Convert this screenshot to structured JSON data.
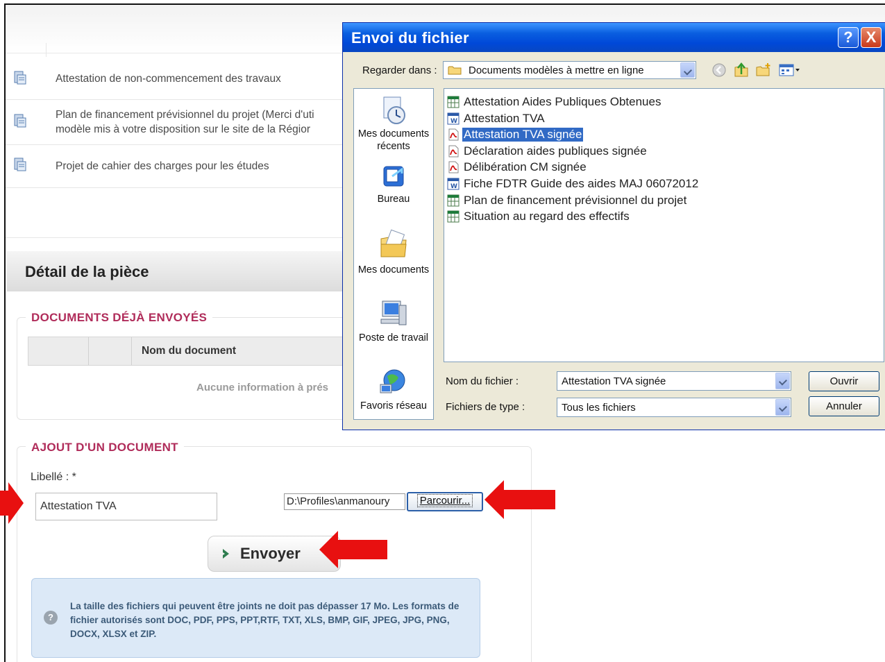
{
  "web": {
    "documents": [
      {
        "label": "Attestation de non-commencement des travaux"
      },
      {
        "label": "Plan de financement prévisionnel du projet (Merci d'uti\nmodèle mis à votre disposition sur le site de la Régior"
      },
      {
        "label": "Projet de cahier des charges pour les études"
      }
    ],
    "detail_title": "Détail de la pièce",
    "sent_docs_legend": "DOCUMENTS DÉJÀ ENVOYÉS",
    "table_header": "Nom du document",
    "empty_message": "Aucune information à prés",
    "add_legend": "AJOUT D'UN DOCUMENT",
    "libelle_label": "Libellé : *",
    "libelle_value": "Attestation TVA",
    "file_path": "D:\\Profiles\\anmanoury",
    "browse_label": "Parcourir...",
    "send_label": "Envoyer",
    "info_text": "La taille des fichiers qui peuvent être joints ne doit pas dépasser 17 Mo. Les formats de fichier autorisés sont DOC, PDF, PPS, PPT,RTF, TXT, XLS, BMP, GIF, JPEG, JPG, PNG, DOCX, XLSX et ZIP."
  },
  "dialog": {
    "title": "Envoi du fichier",
    "help_label": "?",
    "close_label": "X",
    "look_in_label": "Regarder dans :",
    "look_in_value": "Documents modèles à mettre en ligne",
    "places": [
      {
        "label": "Mes documents récents",
        "icon": "recent-documents-icon"
      },
      {
        "label": "Bureau",
        "icon": "desktop-icon"
      },
      {
        "label": "Mes documents",
        "icon": "my-documents-icon"
      },
      {
        "label": "Poste de travail",
        "icon": "my-computer-icon"
      },
      {
        "label": "Favoris réseau",
        "icon": "network-places-icon"
      }
    ],
    "files": [
      {
        "name": "Attestation Aides Publiques Obtenues",
        "type": "excel",
        "selected": false
      },
      {
        "name": "Attestation TVA",
        "type": "word",
        "selected": false
      },
      {
        "name": "Attestation TVA signée",
        "type": "pdf",
        "selected": true
      },
      {
        "name": "Déclaration aides publiques signée",
        "type": "pdf",
        "selected": false
      },
      {
        "name": "Délibération CM signée",
        "type": "pdf",
        "selected": false
      },
      {
        "name": "Fiche FDTR Guide des aides MAJ 06072012",
        "type": "word",
        "selected": false
      },
      {
        "name": "Plan de financement prévisionnel du projet",
        "type": "excel",
        "selected": false
      },
      {
        "name": "Situation au regard des effectifs",
        "type": "excel",
        "selected": false
      }
    ],
    "filename_label": "Nom du fichier :",
    "filename_value": "Attestation TVA signée",
    "filetype_label": "Fichiers de type :",
    "filetype_value": "Tous les fichiers",
    "open_label": "Ouvrir",
    "cancel_label": "Annuler"
  },
  "colors": {
    "accent": "#b02c5a",
    "arrow": "#e81010",
    "selection": "#316ac5",
    "titlebar": "#0a5fe0"
  }
}
